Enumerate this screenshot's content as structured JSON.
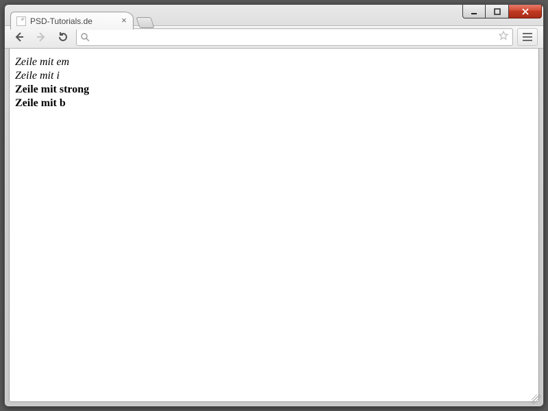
{
  "window": {
    "controls": {
      "minimize": "–",
      "maximize": "□",
      "close": "✕"
    }
  },
  "tab": {
    "title": "PSD-Tutorials.de",
    "close": "×"
  },
  "toolbar": {
    "back_icon": "back-icon",
    "forward_icon": "forward-icon",
    "reload_icon": "reload-icon",
    "menu_icon": "hamburger-icon"
  },
  "omnibox": {
    "value": "",
    "placeholder": ""
  },
  "page": {
    "lines": {
      "em": "Zeile mit em",
      "i": "Zeile mit i",
      "strong": "Zeile mit strong",
      "b": "Zeile mit b"
    }
  }
}
